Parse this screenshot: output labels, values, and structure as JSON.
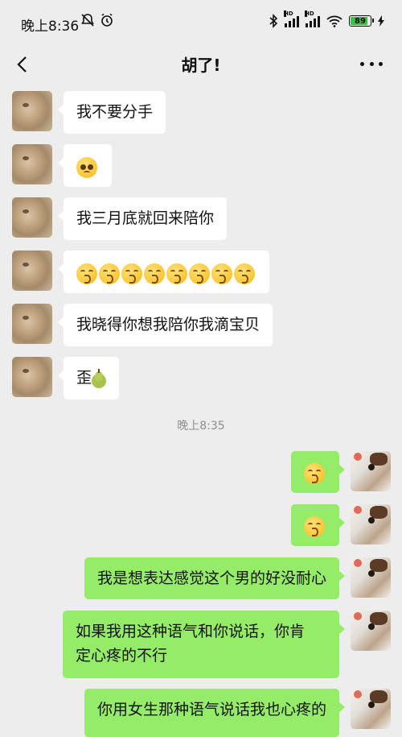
{
  "status_bar": {
    "time": "晚上8:36",
    "battery": "89",
    "network_badge": "HD"
  },
  "nav": {
    "title": "胡了!"
  },
  "timestamp": "晚上8:35",
  "messages": [
    {
      "side": "left",
      "text": "我不要分手"
    },
    {
      "side": "left",
      "emoji": [
        "pleading-face"
      ]
    },
    {
      "side": "left",
      "text": "我三月底就回来陪你"
    },
    {
      "side": "left",
      "emoji": [
        "kissing-face",
        "kissing-face",
        "kissing-face",
        "kissing-face",
        "kissing-face",
        "kissing-face",
        "kissing-face",
        "kissing-face"
      ]
    },
    {
      "side": "left",
      "text": "我晓得你想我陪你我滴宝贝"
    },
    {
      "side": "left",
      "text": "歪",
      "emoji_after": "pear"
    },
    {
      "side": "right",
      "emoji": [
        "kissing-face"
      ]
    },
    {
      "side": "right",
      "emoji": [
        "kissing-face"
      ]
    },
    {
      "side": "right",
      "text": "我是想表达感觉这个男的好没耐心"
    },
    {
      "side": "right",
      "text_lines": [
        "如果我用这种语气和你说话，你肯",
        "定心疼的不行"
      ]
    },
    {
      "side": "right",
      "text": "你用女生那种语气说话我也心疼的"
    }
  ],
  "colors": {
    "background": "#ededed",
    "incoming_bubble": "#ffffff",
    "outgoing_bubble": "#95ec69",
    "timestamp_text": "#8e8e8e"
  }
}
